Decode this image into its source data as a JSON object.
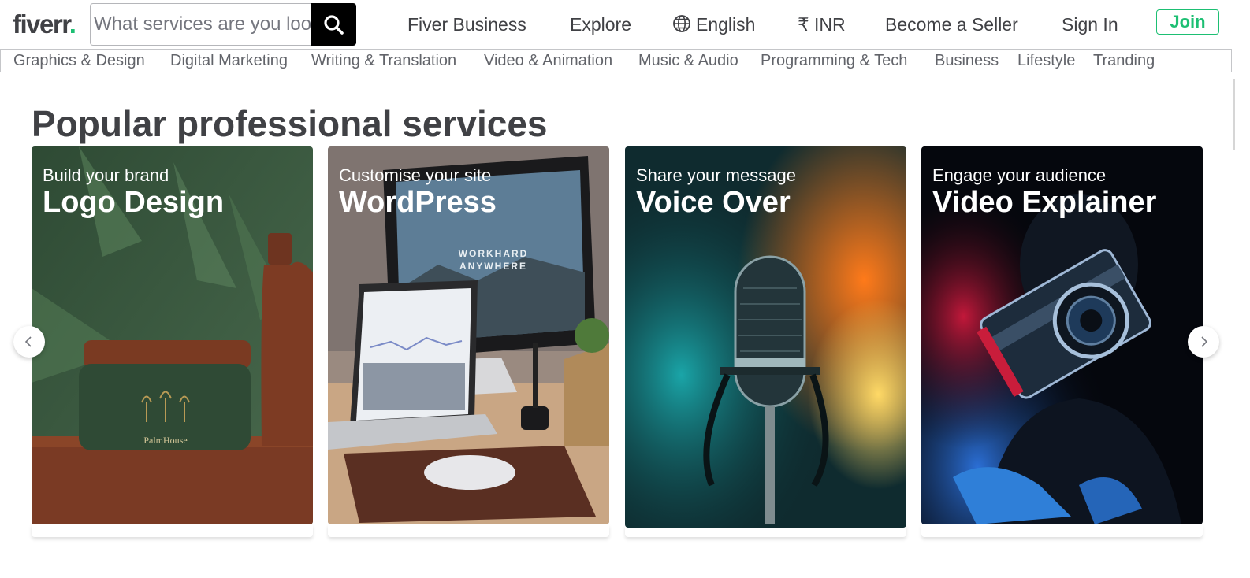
{
  "header": {
    "logo_text": "fiverr",
    "logo_dot": ".",
    "search_placeholder": "What services are you looking for today?",
    "nav": {
      "business": "Fiver Business",
      "explore": "Explore",
      "language": "English",
      "currency": "₹ INR",
      "seller": "Become a Seller",
      "signin": "Sign In",
      "join": "Join"
    }
  },
  "categories": [
    "Graphics & Design",
    "Digital Marketing",
    "Writing & Translation",
    "Video & Animation",
    "Music & Audio",
    "Programming & Tech",
    "Business",
    "Lifestyle",
    "Tranding"
  ],
  "section": {
    "heading": "Popular professional services",
    "cards": [
      {
        "subtitle": "Build your brand",
        "title": "Logo Design",
        "product_text": "PalmHouse"
      },
      {
        "subtitle": "Customise your site",
        "title": "WordPress",
        "screen_text_1": "WORKHARD",
        "screen_text_2": "ANYWHERE"
      },
      {
        "subtitle": "Share your message",
        "title": "Voice Over"
      },
      {
        "subtitle": "Engage your audience",
        "title": "Video Explainer"
      }
    ]
  },
  "colors": {
    "brand_green": "#1dbf73",
    "text": "#404145",
    "muted": "#62646a"
  },
  "icons": {
    "search": "search-icon",
    "globe": "globe-icon",
    "prev": "chevron-left-icon",
    "next": "chevron-right-icon"
  }
}
